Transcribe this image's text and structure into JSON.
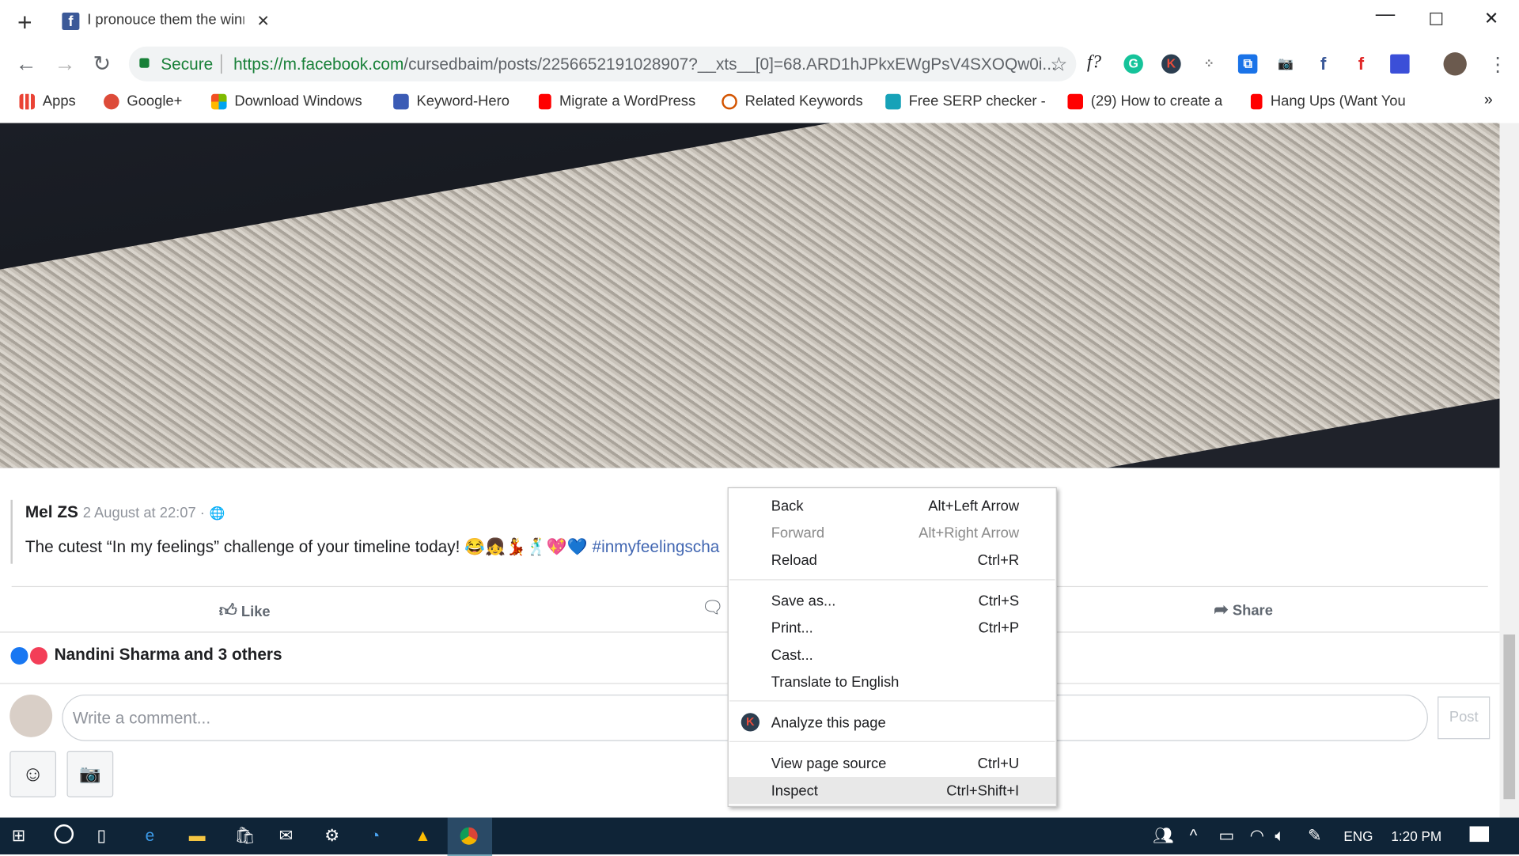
{
  "browser": {
    "tab_title": "I pronouce them the winn",
    "secure_label": "Secure",
    "url_host": "https://m.facebook.com",
    "url_path": "/cursedbaim/posts/2256652191028907?__xts__[0]=68.ARD1hJPkxEWgPsV4SXOQw0i...",
    "bookmarks": [
      {
        "label": "Apps",
        "icon": "apps-grid-icon",
        "color": "#ea4335"
      },
      {
        "label": "Google+",
        "icon": "google-plus-icon",
        "color": "#dd4b39"
      },
      {
        "label": "Download Windows",
        "icon": "windows-icon",
        "color": "#f25022"
      },
      {
        "label": "Keyword-Hero",
        "icon": "keyword-hero-icon",
        "color": "#3b5bb5"
      },
      {
        "label": "Migrate a WordPress",
        "icon": "youtube-icon",
        "color": "#ff0000"
      },
      {
        "label": "Related Keywords",
        "icon": "ring-icon",
        "color": "#d35400"
      },
      {
        "label": "Free SERP checker -",
        "icon": "serp-icon",
        "color": "#17a2b8"
      },
      {
        "label": "(29) How to create a",
        "icon": "youtube-icon",
        "color": "#ff0000"
      },
      {
        "label": "Hang Ups (Want You",
        "icon": "youtube-icon",
        "color": "#ff0000"
      }
    ],
    "extensions": [
      "font-finder-icon",
      "grammarly-icon",
      "k-icon",
      "grid-dots-icon",
      "translate-icon",
      "camera-icon",
      "facebook-icon",
      "flipboard-icon",
      "extension-icon"
    ]
  },
  "post": {
    "author": "Mel ZS",
    "time": "2 August at 22:07 ·",
    "text": "The cutest “In my feelings” challenge of your timeline today! 😂👧💃🕺💖💙",
    "hashtag": "#inmyfeelingscha",
    "like_label": "Like",
    "share_label": "Share",
    "reactions": "Nandini Sharma and 3 others",
    "comment_placeholder": "Write a comment...",
    "post_button": "Post"
  },
  "context_menu": {
    "groups": [
      [
        {
          "label": "Back",
          "shortcut": "Alt+Left Arrow",
          "enabled": true
        },
        {
          "label": "Forward",
          "shortcut": "Alt+Right Arrow",
          "enabled": false
        },
        {
          "label": "Reload",
          "shortcut": "Ctrl+R",
          "enabled": true
        }
      ],
      [
        {
          "label": "Save as...",
          "shortcut": "Ctrl+S",
          "enabled": true
        },
        {
          "label": "Print...",
          "shortcut": "Ctrl+P",
          "enabled": true
        },
        {
          "label": "Cast...",
          "shortcut": "",
          "enabled": true
        },
        {
          "label": "Translate to English",
          "shortcut": "",
          "enabled": true
        }
      ],
      [
        {
          "label": "Analyze this page",
          "shortcut": "",
          "enabled": true
        }
      ],
      [
        {
          "label": "View page source",
          "shortcut": "Ctrl+U",
          "enabled": true
        },
        {
          "label": "Inspect",
          "shortcut": "Ctrl+Shift+I",
          "enabled": true,
          "highlighted": true
        }
      ]
    ]
  },
  "taskbar": {
    "language": "ENG",
    "time": "1:20 PM"
  }
}
